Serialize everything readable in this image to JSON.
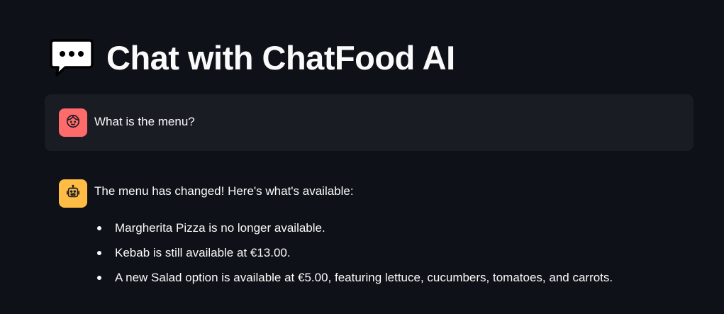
{
  "header": {
    "icon": "speech-balloon-icon",
    "title": "Chat with ChatFood AI"
  },
  "messages": [
    {
      "role": "user",
      "avatar_icon": "user-face-icon",
      "avatar_color": "#ff6b6b",
      "text": "What is the menu?"
    },
    {
      "role": "assistant",
      "avatar_icon": "robot-icon",
      "avatar_color": "#ffbd45",
      "intro": "The menu has changed! Here's what's available:",
      "items": [
        "Margherita Pizza is no longer available.",
        "Kebab is still available at €13.00.",
        "A new Salad option is available at €5.00, featuring lettuce, cucumbers, tomatoes, and carrots."
      ]
    }
  ],
  "colors": {
    "background": "#0e1117",
    "user_bubble": "#1a1c24",
    "text": "#fafafa"
  }
}
